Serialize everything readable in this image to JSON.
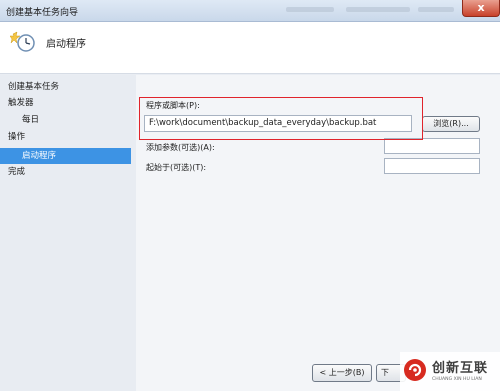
{
  "window": {
    "title": "创建基本任务向导",
    "close_label": "x"
  },
  "header": {
    "title": "启动程序",
    "icon": "wizard-clock-icon"
  },
  "sidebar": {
    "items": [
      {
        "label": "创建基本任务"
      },
      {
        "label": "触发器"
      },
      {
        "label": "每日"
      },
      {
        "label": "操作"
      },
      {
        "label": "启动程序",
        "selected": true
      },
      {
        "label": "完成"
      }
    ]
  },
  "form": {
    "program_label": "程序或脚本(P):",
    "program_value": "F:\\work\\document\\backup_data_everyday\\backup.bat",
    "browse_label": "浏览(R)...",
    "args_label": "添加参数(可选)(A):",
    "args_value": "",
    "startin_label": "起始于(可选)(T):",
    "startin_value": ""
  },
  "footer": {
    "back_label": "< 上一步(B)",
    "next_label": "下"
  },
  "watermark": {
    "main": "创新互联",
    "sub": "CHUANG XIN HU LIAN",
    "icon": "brand-logo-icon"
  },
  "colors": {
    "highlight": "#e0242c",
    "selection": "#3d93e4",
    "close_button": "#c8412a"
  }
}
